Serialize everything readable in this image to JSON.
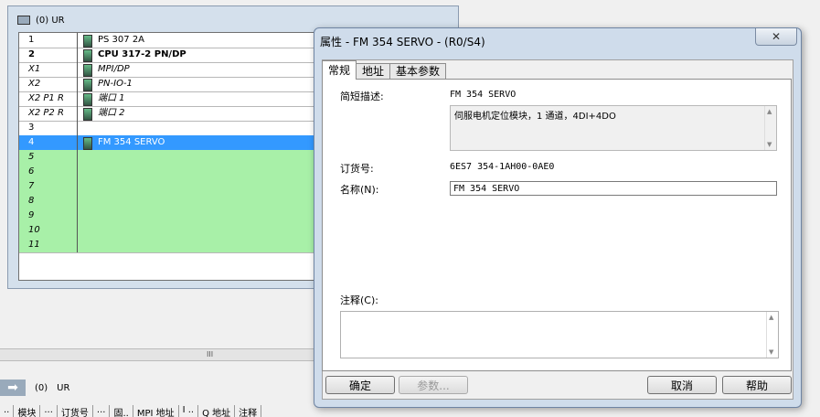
{
  "rack": {
    "title": "(0)   UR",
    "rows": [
      {
        "slot": "1",
        "module": "PS 307 2A",
        "style": "plain",
        "icon": true
      },
      {
        "slot": "2",
        "module": "CPU 317-2 PN/DP",
        "style": "bold",
        "icon": true
      },
      {
        "slot": "X1",
        "module": "MPI/DP",
        "style": "italic",
        "icon": true
      },
      {
        "slot": "X2",
        "module": "PN-IO-1",
        "style": "italic",
        "icon": true
      },
      {
        "slot": "X2 P1 R",
        "module": "端口 1",
        "style": "italic",
        "icon": true
      },
      {
        "slot": "X2 P2 R",
        "module": "端口 2",
        "style": "italic",
        "icon": true
      },
      {
        "slot": "3",
        "module": "",
        "style": "plain",
        "icon": false
      },
      {
        "slot": "4",
        "module": "FM 354 SERVO",
        "style": "sel",
        "icon": true
      },
      {
        "slot": "5",
        "module": "",
        "style": "green",
        "icon": false
      },
      {
        "slot": "6",
        "module": "",
        "style": "green",
        "icon": false
      },
      {
        "slot": "7",
        "module": "",
        "style": "green",
        "icon": false
      },
      {
        "slot": "8",
        "module": "",
        "style": "green",
        "icon": false
      },
      {
        "slot": "9",
        "module": "",
        "style": "green",
        "icon": false
      },
      {
        "slot": "10",
        "module": "",
        "style": "green",
        "icon": false
      },
      {
        "slot": "11",
        "module": "",
        "style": "green",
        "icon": false
      }
    ]
  },
  "bottom": {
    "station": "(0)",
    "rack_name": "UR",
    "grip": "III",
    "headers": [
      "..",
      "模块",
      "...",
      "订货号",
      "...",
      "固..",
      "MPI 地址",
      "I ..",
      "Q 地址",
      "注释"
    ]
  },
  "dialog": {
    "title": "属性 - FM 354 SERVO - (R0/S4)",
    "close_glyph": "✕",
    "tabs": [
      "常规",
      "地址",
      "基本参数"
    ],
    "short_desc_label": "简短描述:",
    "short_desc_value": "FM 354 SERVO",
    "long_desc": "伺服电机定位模块，1 通道，4DI+4DO",
    "order_no_label": "订货号:",
    "order_no_value": "6ES7 354-1AH00-0AE0",
    "name_label": "名称(N):",
    "name_value": "FM 354 SERVO",
    "comment_label": "注释(C):",
    "buttons": {
      "ok": "确定",
      "params": "参数...",
      "cancel": "取消",
      "help": "帮助"
    }
  }
}
